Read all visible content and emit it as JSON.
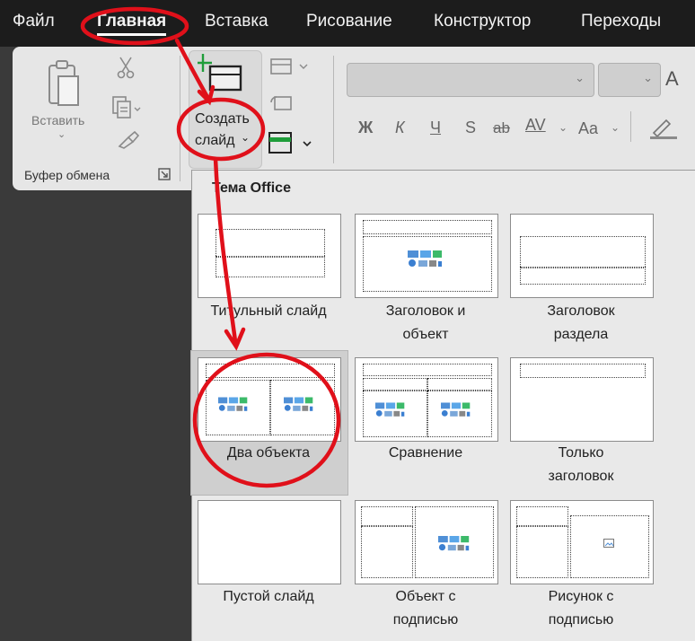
{
  "menu": {
    "tabs": [
      "Файл",
      "Главная",
      "Вставка",
      "Рисование",
      "Конструктор",
      "Переходы"
    ],
    "active": "Главная"
  },
  "ribbon": {
    "paste_label": "Вставить",
    "clipboard_group": "Буфер обмена",
    "new_slide_label_1": "Создать",
    "new_slide_label_2": "слайд",
    "font_size_label": "A",
    "format_buttons": [
      "Ж",
      "К",
      "Ч",
      "S",
      "ab",
      "AV",
      "Aa"
    ]
  },
  "gallery": {
    "title": "Тема Office",
    "layouts": [
      {
        "line1": "Титульный слайд",
        "line2": ""
      },
      {
        "line1": "Заголовок и",
        "line2": "объект"
      },
      {
        "line1": "Заголовок",
        "line2": "раздела"
      },
      {
        "line1": "Два объекта",
        "line2": ""
      },
      {
        "line1": "Сравнение",
        "line2": ""
      },
      {
        "line1": "Только",
        "line2": "заголовок"
      },
      {
        "line1": "Пустой слайд",
        "line2": ""
      },
      {
        "line1": "Объект с",
        "line2": "подписью"
      },
      {
        "line1": "Рисунок с",
        "line2": "подписью"
      }
    ],
    "selected_index": 3
  },
  "colors": {
    "annotation_red": "#e0101a",
    "menubar_bg": "#1c1c1c",
    "ribbon_bg": "#e6e6e6"
  }
}
